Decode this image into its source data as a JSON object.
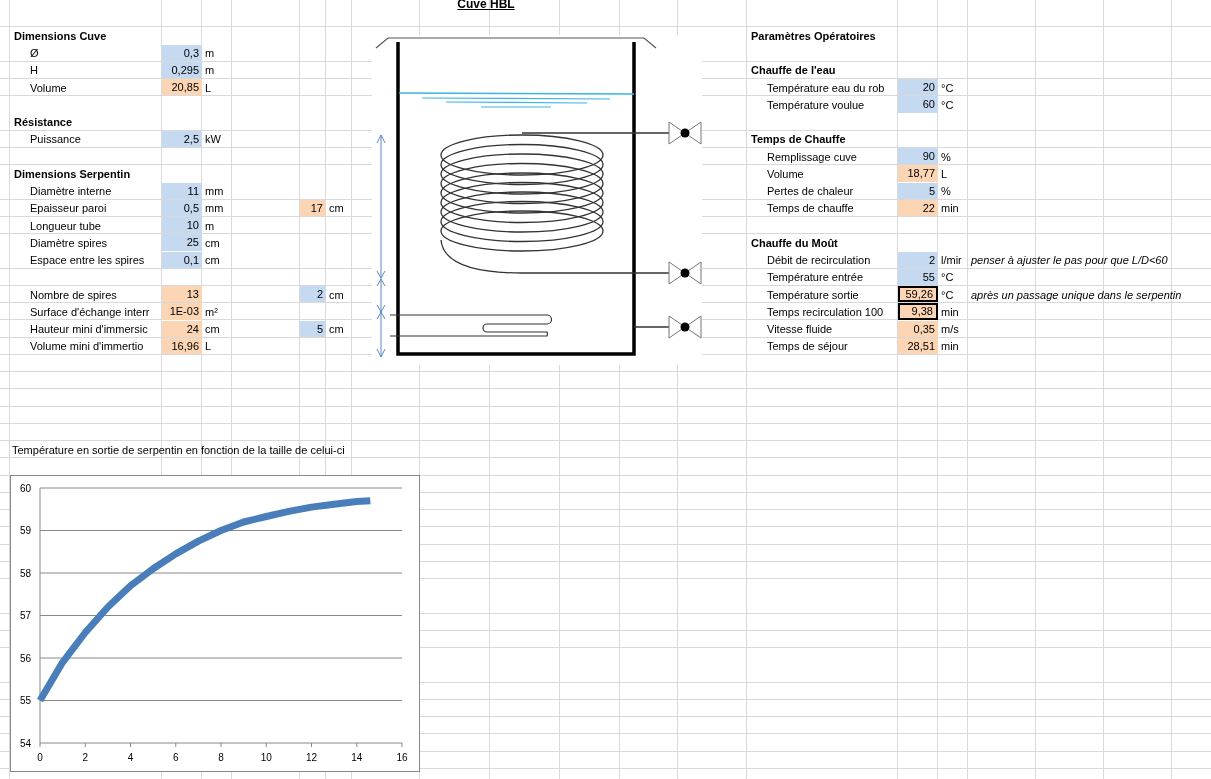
{
  "title": "Cuve HBL",
  "left_sections": [
    {
      "heading": "Dimensions Cuve",
      "rows": [
        {
          "label": "Ø",
          "value": "0,3",
          "unit": "m",
          "kind": "input"
        },
        {
          "label": "H",
          "value": "0,295",
          "unit": "m",
          "kind": "input"
        },
        {
          "label": "Volume",
          "value": "20,85",
          "unit": "L",
          "kind": "result"
        }
      ]
    },
    {
      "heading": "Résistance",
      "rows": [
        {
          "label": "Puissance",
          "value": "2,5",
          "unit": "kW",
          "kind": "input"
        }
      ]
    },
    {
      "heading": "Dimensions Serpentin",
      "rows": [
        {
          "label": "Diamètre interne",
          "value": "11",
          "unit": "mm",
          "kind": "input"
        },
        {
          "label": "Epaisseur paroi",
          "value": "0,5",
          "unit": "mm",
          "kind": "input",
          "side": {
            "value": "17",
            "unit": "cm",
            "kind": "result"
          }
        },
        {
          "label": "Longueur tube",
          "value": "10",
          "unit": "m",
          "kind": "input"
        },
        {
          "label": "Diamètre spires",
          "value": "25",
          "unit": "cm",
          "kind": "input"
        },
        {
          "label": "Espace entre les spires",
          "value": "0,1",
          "unit": "cm",
          "kind": "input"
        }
      ]
    },
    {
      "rows": [
        {
          "label": "Nombre de spires",
          "value": "13",
          "kind": "result",
          "side": {
            "value": "2",
            "unit": "cm",
            "kind": "input"
          }
        },
        {
          "label": "Surface d'échange interr",
          "value": "1E-03",
          "unit": "m²",
          "kind": "result"
        },
        {
          "label": "Hauteur mini d'immersic",
          "value": "24",
          "unit": "cm",
          "kind": "result",
          "side": {
            "value": "5",
            "unit": "cm",
            "kind": "input"
          }
        },
        {
          "label": "Volume mini d'immertio",
          "value": "16,96",
          "unit": "L",
          "kind": "result"
        }
      ]
    }
  ],
  "right_sections": [
    {
      "heading": "Paramètres Opératoires"
    },
    {
      "heading": "Chauffe de l'eau",
      "rows": [
        {
          "label": "Température eau du rob",
          "value": "20",
          "unit": "°C",
          "kind": "input"
        },
        {
          "label": "Température voulue",
          "value": "60",
          "unit": "°C",
          "kind": "input"
        }
      ]
    },
    {
      "heading": "Temps de Chauffe",
      "rows": [
        {
          "label": "Remplissage cuve",
          "value": "90",
          "unit": "%",
          "kind": "input"
        },
        {
          "label": "Volume",
          "value": "18,77",
          "unit": "L",
          "kind": "result"
        },
        {
          "label": "Pertes de chaleur",
          "value": "5",
          "unit": "%",
          "kind": "input"
        },
        {
          "label": "Temps de chauffe",
          "value": "22",
          "unit": "min",
          "kind": "result"
        }
      ]
    },
    {
      "heading": "Chauffe du Moût",
      "rows": [
        {
          "label": "Débit de recirculation",
          "value": "2",
          "unit": "l/mir",
          "kind": "input",
          "outlined": false,
          "note": "penser à ajuster le pas pour que L/D<60"
        },
        {
          "label": "Température entrée",
          "value": "55",
          "unit": "°C",
          "kind": "input",
          "outlined": false
        },
        {
          "label": "Température sortie",
          "value": "59,26",
          "unit": "°C",
          "kind": "result",
          "outlined": true,
          "note": "après un passage unique dans le serpentin"
        },
        {
          "label": "Temps recirculation 100",
          "value": "9,38",
          "unit": "min",
          "kind": "result",
          "outlined": true
        },
        {
          "label": "Vitesse fluide",
          "value": "0,35",
          "unit": "m/s",
          "kind": "result",
          "outlined": false
        },
        {
          "label": "Temps de séjour",
          "value": "28,51",
          "unit": "min",
          "kind": "result",
          "outlined": false
        }
      ]
    }
  ],
  "chart_caption": "Température en sortie de serpentin en fonction de la taille de celui-ci",
  "chart_data": {
    "type": "line",
    "x": [
      0,
      1,
      2,
      3,
      4,
      5,
      6,
      7,
      8,
      9,
      10,
      11,
      12,
      13,
      14,
      14.6
    ],
    "series": [
      {
        "color": "#4a7ebb",
        "values": [
          55,
          55.9,
          56.6,
          57.2,
          57.7,
          58.1,
          58.45,
          58.75,
          59.0,
          59.2,
          59.33,
          59.45,
          59.55,
          59.62,
          59.68,
          59.7
        ]
      }
    ],
    "grid": true,
    "xlim": [
      0,
      16
    ],
    "ylim": [
      54,
      60
    ],
    "xticks": [
      0,
      2,
      4,
      6,
      8,
      10,
      12,
      14,
      16
    ],
    "yticks": [
      54,
      55,
      56,
      57,
      58,
      59,
      60
    ]
  }
}
